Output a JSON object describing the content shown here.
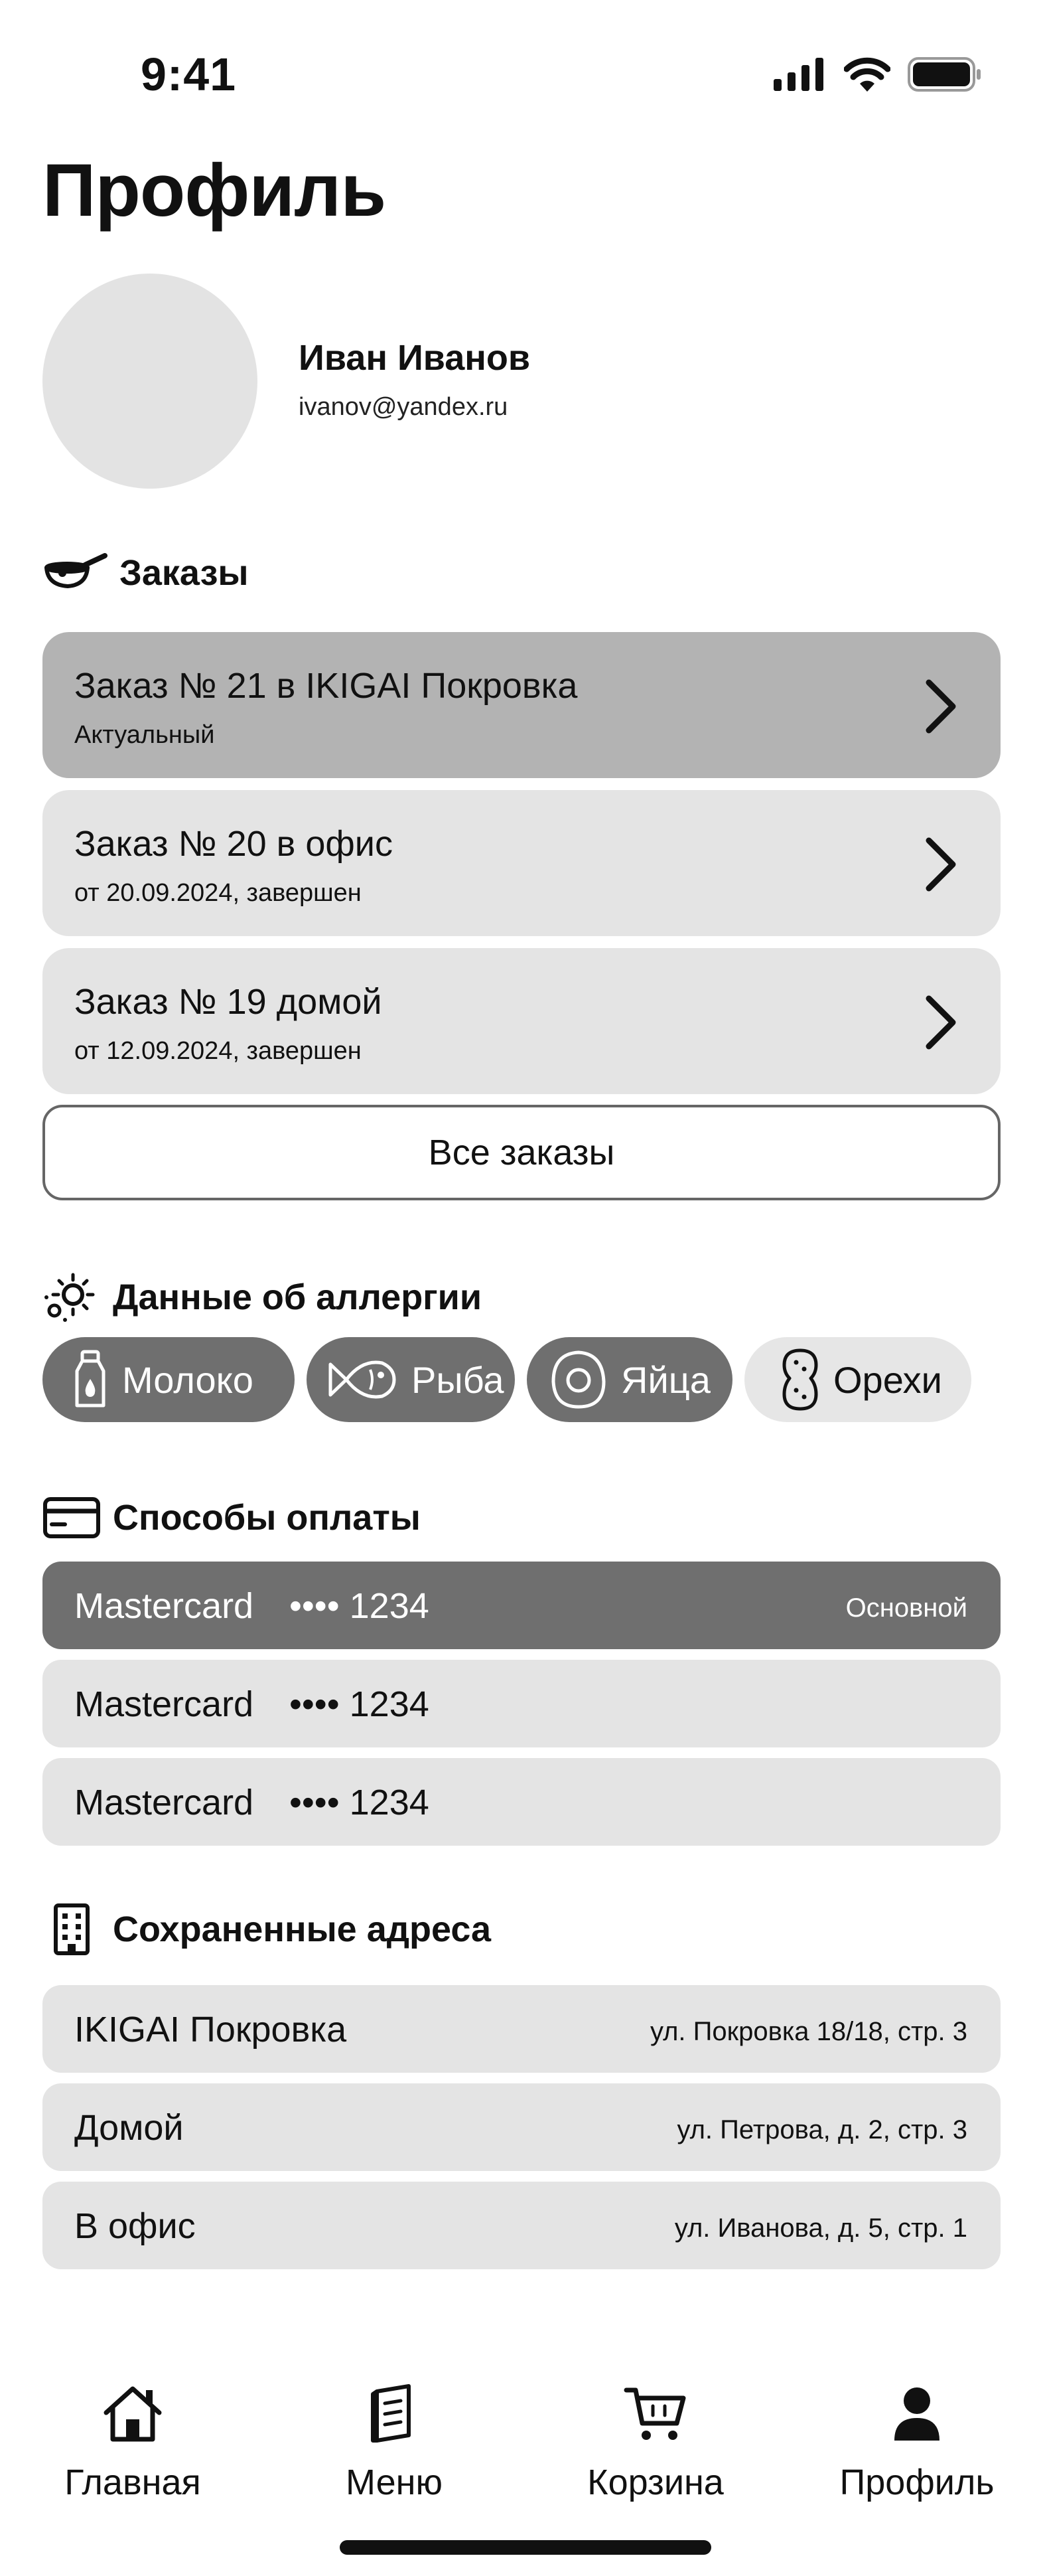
{
  "status_bar": {
    "time": "9:41"
  },
  "page": {
    "title": "Профиль"
  },
  "user": {
    "name": "Иван Иванов",
    "email": "ivanov@yandex.ru"
  },
  "sections": {
    "orders": "Заказы",
    "allergy": "Данные об аллергии",
    "payment": "Способы оплаты",
    "addresses": "Сохраненные адреса"
  },
  "orders": [
    {
      "title": "Заказ № 21 в IKIGAI Покровка",
      "status": "Актуальный"
    },
    {
      "title": "Заказ № 20 в офис",
      "status": "от 20.09.2024, завершен"
    },
    {
      "title": "Заказ № 19 домой",
      "status": "от 12.09.2024, завершен"
    }
  ],
  "all_orders_label": "Все заказы",
  "allergies": [
    {
      "label": "Молоко",
      "icon": "milk-bottle-icon",
      "selected": true
    },
    {
      "label": "Рыба",
      "icon": "fish-icon",
      "selected": true
    },
    {
      "label": "Яйца",
      "icon": "egg-icon",
      "selected": true
    },
    {
      "label": "Орехи",
      "icon": "peanut-icon",
      "selected": false
    }
  ],
  "payments": [
    {
      "brand": "Mastercard",
      "number": "•••• 1234",
      "badge": "Основной"
    },
    {
      "brand": "Mastercard",
      "number": "•••• 1234"
    },
    {
      "brand": "Mastercard",
      "number": "•••• 1234"
    }
  ],
  "addresses": [
    {
      "name": "IKIGAI Покровка",
      "detail": "ул. Покровка 18/18, стр. 3"
    },
    {
      "name": "Домой",
      "detail": "ул. Петрова, д. 2, стр. 3"
    },
    {
      "name": "В офис",
      "detail": "ул. Иванова, д. 5, стр. 1"
    }
  ],
  "tabs": [
    {
      "label": "Главная",
      "icon": "home-icon"
    },
    {
      "label": "Меню",
      "icon": "menu-book-icon"
    },
    {
      "label": "Корзина",
      "icon": "cart-icon"
    },
    {
      "label": "Профиль",
      "icon": "profile-icon",
      "active": true
    }
  ],
  "colors": {
    "active_order": "#b3b3b3",
    "card": "#e4e4e4",
    "selected_chip": "#6f6f6f",
    "primary_payment": "#6f6f6f"
  }
}
